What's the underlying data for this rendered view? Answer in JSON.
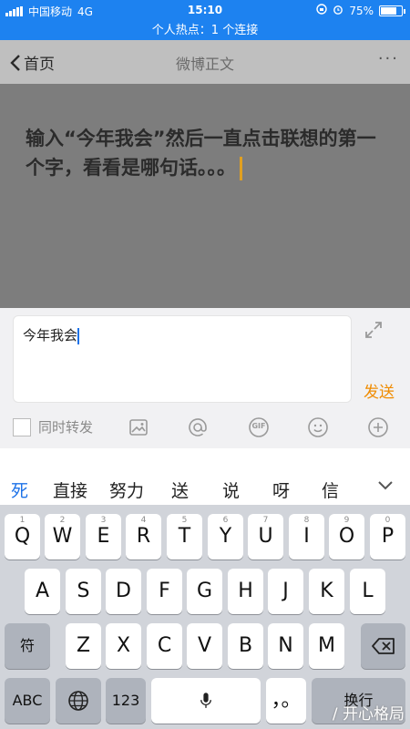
{
  "status_bar": {
    "carrier": "中国移动",
    "network": "4G",
    "time": "15:10",
    "battery": "75%",
    "battery_level": 0.75,
    "hotspot_text": "个人热点：1 个连接"
  },
  "nav": {
    "back_label": "首页",
    "title": "微博正文",
    "more_label": "···"
  },
  "post": {
    "text": "输入“今年我会”然后一直点击联想的第一个字，看看是哪句话。。。"
  },
  "compose": {
    "input_value": "今年我会",
    "send_label": "发送",
    "repost_label": "同时转发",
    "tools": [
      "image-icon",
      "at-icon",
      "gif-icon",
      "emoji-icon",
      "plus-icon"
    ],
    "gif_text": "GIF"
  },
  "candidates": [
    "死",
    "直接",
    "努力",
    "送",
    "说",
    "呀",
    "信"
  ],
  "keyboard": {
    "row1": [
      {
        "label": "Q",
        "num": "1"
      },
      {
        "label": "W",
        "num": "2"
      },
      {
        "label": "E",
        "num": "3"
      },
      {
        "label": "R",
        "num": "4"
      },
      {
        "label": "T",
        "num": "5"
      },
      {
        "label": "Y",
        "num": "6"
      },
      {
        "label": "U",
        "num": "7"
      },
      {
        "label": "I",
        "num": "8"
      },
      {
        "label": "O",
        "num": "9"
      },
      {
        "label": "P",
        "num": "0"
      }
    ],
    "row2": [
      "A",
      "S",
      "D",
      "F",
      "G",
      "H",
      "J",
      "K",
      "L"
    ],
    "row3": [
      "Z",
      "X",
      "C",
      "V",
      "B",
      "N",
      "M"
    ],
    "symbol_label": "符",
    "abc_label": "ABC",
    "num_label": "123",
    "punct_label": "，。",
    "return_label": "换行"
  },
  "watermark": "/ 开心格局",
  "colors": {
    "accent_blue": "#1d82f0",
    "send_orange": "#f08c00",
    "candidate_active": "#1d72e8"
  }
}
